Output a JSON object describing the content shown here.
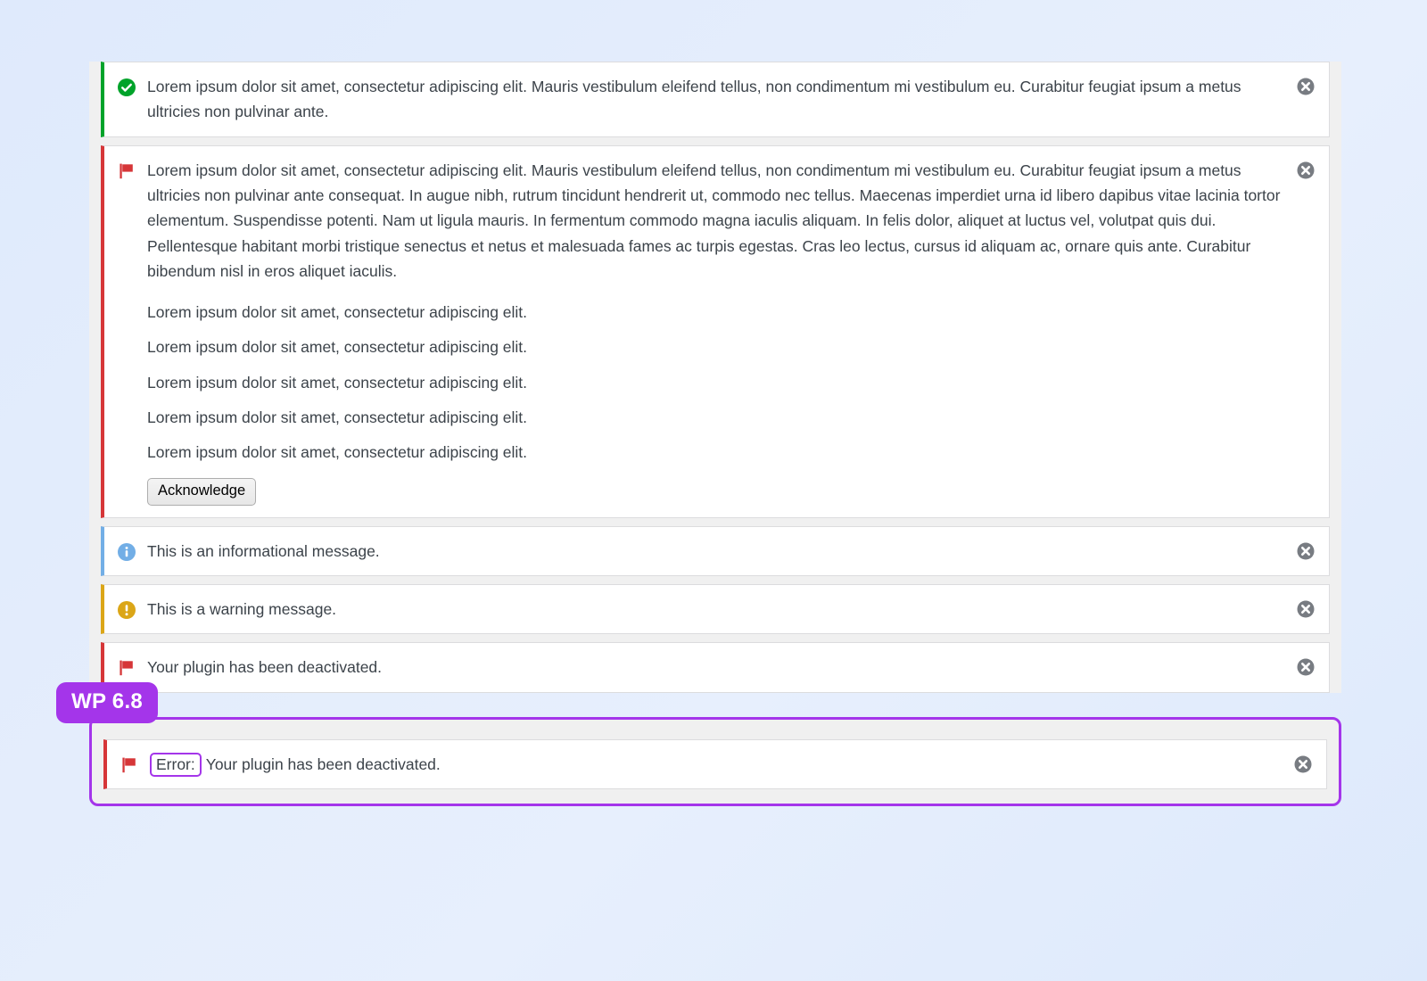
{
  "background": {
    "from": "#dfeafc",
    "to": "#dde9fb"
  },
  "colors": {
    "success": "#00a32a",
    "error": "#d63638",
    "info": "#72aee6",
    "warning": "#dba617",
    "highlight": "#a435ea",
    "notice_bg": "#ffffff",
    "area_bg": "#f0f0f0",
    "text": "#3c434a"
  },
  "notices": [
    {
      "type": "success",
      "icon": "check-circle-icon",
      "dismiss_label": "Dismiss this notice",
      "paragraphs": [
        "Lorem ipsum dolor sit amet, consectetur adipiscing elit. Mauris vestibulum eleifend tellus, non condimentum mi vestibulum eu. Curabitur feugiat ipsum a metus ultricies non pulvinar ante."
      ]
    },
    {
      "type": "error",
      "icon": "flag-icon",
      "dismiss_label": "Dismiss this notice",
      "paragraphs": [
        "Lorem ipsum dolor sit amet, consectetur adipiscing elit. Mauris vestibulum eleifend tellus, non condimentum mi vestibulum eu. Curabitur feugiat ipsum a metus ultricies non pulvinar ante consequat. In augue nibh, rutrum tincidunt hendrerit ut, commodo nec tellus. Maecenas imperdiet urna id libero dapibus vitae lacinia tortor elementum. Suspendisse potenti. Nam ut ligula mauris. In fermentum commodo magna iaculis aliquam. In felis dolor, aliquet at luctus vel, volutpat quis dui. Pellentesque habitant morbi tristique senectus et netus et malesuada fames ac turpis egestas. Cras leo lectus, cursus id aliquam ac, ornare quis ante. Curabitur bibendum nisl in eros aliquet iaculis."
      ],
      "lines": [
        "Lorem ipsum dolor sit amet, consectetur adipiscing elit.",
        "Lorem ipsum dolor sit amet, consectetur adipiscing elit.",
        "Lorem ipsum dolor sit amet, consectetur adipiscing elit.",
        "Lorem ipsum dolor sit amet, consectetur adipiscing elit.",
        "Lorem ipsum dolor sit amet, consectetur adipiscing elit."
      ],
      "button_label": "Acknowledge"
    },
    {
      "type": "info",
      "icon": "info-circle-icon",
      "dismiss_label": "Dismiss this notice",
      "paragraphs": [
        "This is an informational message."
      ]
    },
    {
      "type": "warning",
      "icon": "exclamation-circle-icon",
      "dismiss_label": "Dismiss this notice",
      "paragraphs": [
        "This is a warning message."
      ]
    },
    {
      "type": "error",
      "icon": "flag-icon",
      "dismiss_label": "Dismiss this notice",
      "paragraphs": [
        "Your plugin has been deactivated."
      ]
    }
  ],
  "highlight_group": {
    "badge_label": "WP 6.8",
    "notice": {
      "type": "error",
      "icon": "flag-icon",
      "dismiss_label": "Dismiss this notice",
      "prefix": "Error:",
      "text": "Your plugin has been deactivated."
    }
  }
}
